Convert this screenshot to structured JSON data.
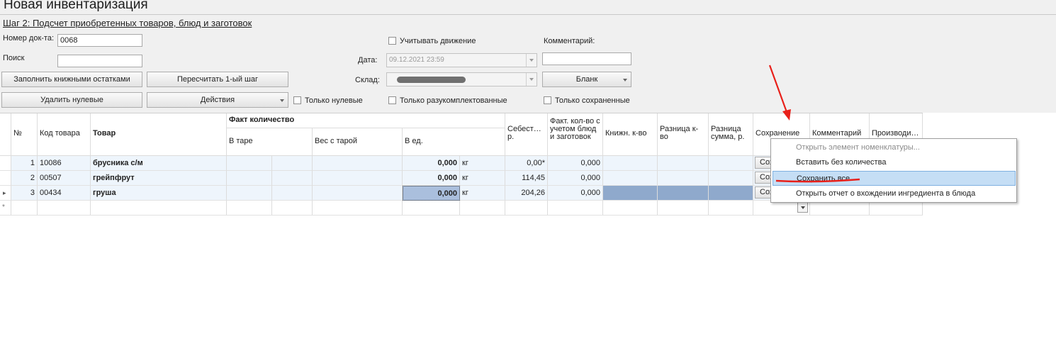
{
  "window": {
    "title": "Новая инвентаризация"
  },
  "step_link": "Шаг 2: Подсчет приобретенных товаров, блюд и заготовок",
  "form": {
    "doc_number_label": "Номер док-та:",
    "doc_number_value": "0068",
    "search_label": "Поиск",
    "search_value": "",
    "track_movement_label": "Учитывать движение",
    "date_label": "Дата:",
    "date_value": "09.12.2021 23:59",
    "warehouse_label": "Склад:",
    "comment_label": "Комментарий:",
    "comment_value": ""
  },
  "buttons": {
    "fill_book_balances": "Заполнить книжными остатками",
    "recalc_first_step": "Пересчитать 1-ый шаг",
    "blank": "Бланк",
    "delete_zero": "Удалить нулевые",
    "actions": "Действия"
  },
  "filters": {
    "only_zero": "Только нулевые",
    "only_unassembled": "Только разукомплектованные",
    "only_saved": "Только сохраненные"
  },
  "table": {
    "headers": {
      "num": "№",
      "code": "Код товара",
      "item": "Товар",
      "fact_qty_group": "Факт количество",
      "in_container": "В таре",
      "weight_with_container": "Вес с тарой",
      "in_units": "В ед.",
      "cost": "Себест… р.",
      "fact_qty_with_dishes": "Факт. кол-во с учетом блюд и заготовок",
      "book_qty": "Книжн. к-во",
      "diff_qty": "Разница к-во",
      "diff_sum": "Разница сумма, р.",
      "saving": "Сохранение",
      "comment": "Комментарий",
      "producer": "Производи…"
    },
    "rows": [
      {
        "num": "1",
        "code": "10086",
        "item": "брусника с/м",
        "in_units": "0,000",
        "unit": "кг",
        "cost": "0,00*",
        "fact_qty": "0,000",
        "save": "Сохр"
      },
      {
        "num": "2",
        "code": "00507",
        "item": "грейпфрут",
        "in_units": "0,000",
        "unit": "кг",
        "cost": "114,45",
        "fact_qty": "0,000",
        "save": "Сохр"
      },
      {
        "num": "3",
        "code": "00434",
        "item": "груша",
        "in_units": "0,000",
        "unit": "кг",
        "cost": "204,26",
        "fact_qty": "0,000",
        "save": "Сохр"
      }
    ],
    "new_row_marker": "*",
    "current_row_marker": "▸"
  },
  "context_menu": {
    "items": [
      {
        "label": "Открыть элемент номенклатуры...",
        "disabled": true
      },
      {
        "label": "Вставить без количества",
        "disabled": false
      },
      {
        "label": "Сохранить все",
        "highlighted": true
      },
      {
        "label": "Открыть отчет о вхождении ингредиента в блюда",
        "disabled": false
      }
    ]
  },
  "colors": {
    "toolbar_bg": "#f0f0f0",
    "row_light_blue": "#eef5fc",
    "row_selected_blue": "#8fa9cc",
    "menu_highlight": "#c5def5",
    "annotation_red": "#e8201a"
  }
}
